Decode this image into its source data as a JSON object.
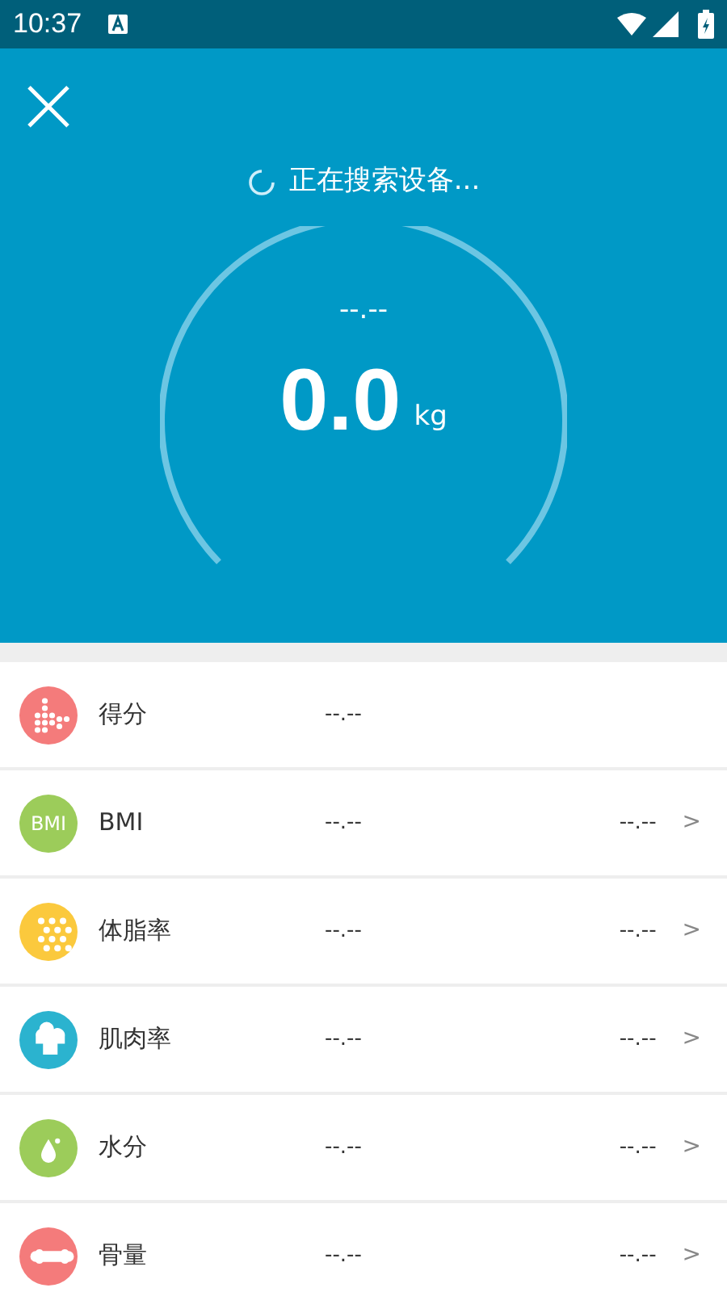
{
  "status_bar": {
    "time": "10:37"
  },
  "header": {
    "status": "正在搜索设备...",
    "secondary_reading": "--.--",
    "weight": "0.0",
    "unit": "kg"
  },
  "rows": [
    {
      "kind": "score",
      "color": "#f47b7b",
      "label": "得分",
      "value": "--.--"
    },
    {
      "kind": "bmi",
      "color": "#9ccc5a",
      "icon_label": "BMI",
      "label": "BMI",
      "value": "--.--",
      "extra": "--.--",
      "arrow": ">"
    },
    {
      "kind": "fat",
      "color": "#fbc93d",
      "label": "体脂率",
      "value": "--.--",
      "extra": "--.--",
      "arrow": ">"
    },
    {
      "kind": "muscle",
      "color": "#2bb3cf",
      "label": "肌肉率",
      "value": "--.--",
      "extra": "--.--",
      "arrow": ">"
    },
    {
      "kind": "water",
      "color": "#9ccc5a",
      "label": "水分",
      "value": "--.--",
      "extra": "--.--",
      "arrow": ">"
    },
    {
      "kind": "bone",
      "color": "#f47b7b",
      "label": "骨量",
      "value": "--.--",
      "extra": "--.--",
      "arrow": ">"
    }
  ]
}
